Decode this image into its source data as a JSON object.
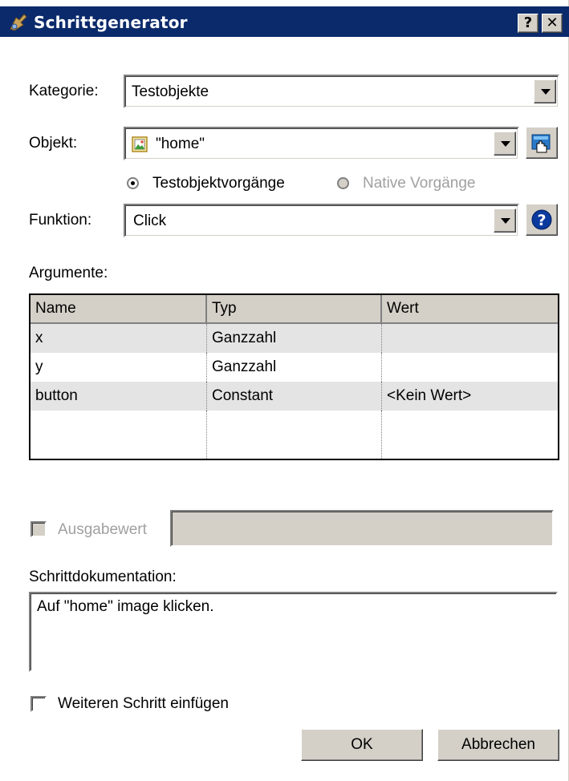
{
  "window": {
    "title": "Schrittgenerator",
    "help_glyph": "?",
    "close_glyph": "✕"
  },
  "kategorie": {
    "label": "Kategorie:",
    "value": "Testobjekte"
  },
  "objekt": {
    "label": "Objekt:",
    "value": "\"home\""
  },
  "mode": {
    "option1": {
      "label": "Testobjektvorgänge",
      "selected": true
    },
    "option2": {
      "label": "Native Vorgänge",
      "selected": false,
      "disabled": true
    }
  },
  "funktion": {
    "label": "Funktion:",
    "value": "Click"
  },
  "argumente": {
    "label": "Argumente:",
    "columns": [
      "Name",
      "Typ",
      "Wert"
    ],
    "rows": [
      {
        "name": "x",
        "typ": "Ganzzahl",
        "wert": ""
      },
      {
        "name": "y",
        "typ": "Ganzzahl",
        "wert": ""
      },
      {
        "name": "button",
        "typ": "Constant",
        "wert": "<Kein Wert>"
      }
    ]
  },
  "ausgabewert": {
    "label": "Ausgabewert",
    "checked": false,
    "disabled": true,
    "value": ""
  },
  "doku": {
    "label": "Schrittdokumentation:",
    "value": "Auf \"home\" image klicken."
  },
  "weiteren": {
    "label": "Weiteren Schritt einfügen",
    "checked": false
  },
  "buttons": {
    "ok": "OK",
    "cancel": "Abbrechen"
  },
  "colors": {
    "titlebar": "#0b2a6b",
    "face": "#d4d0c8",
    "help_icon": "#0a3a9e"
  }
}
